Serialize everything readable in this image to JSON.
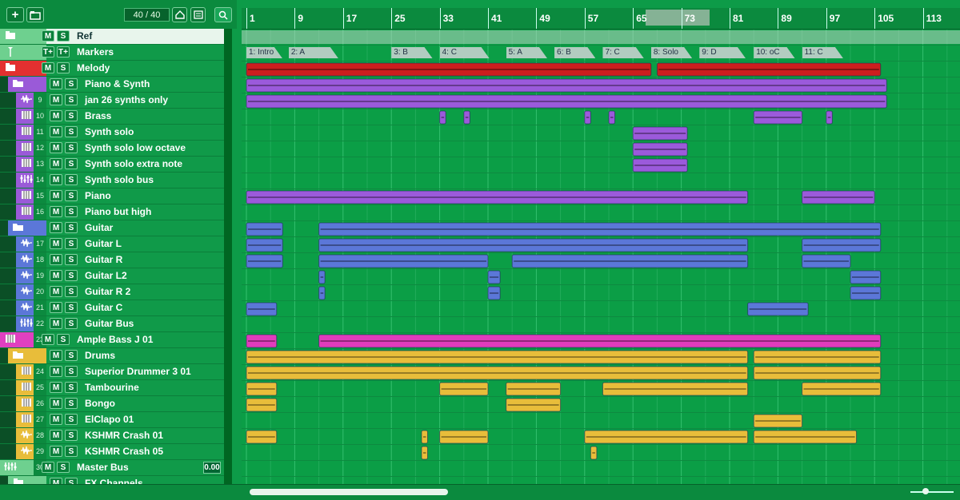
{
  "toolbar": {
    "add_track": "+",
    "track_count": "40 / 40"
  },
  "ruler": {
    "bars": [
      "1",
      "9",
      "17",
      "25",
      "33",
      "41",
      "49",
      "57",
      "65",
      "73",
      "81",
      "89",
      "97",
      "105",
      "113"
    ],
    "loop_label": "73"
  },
  "markers": [
    {
      "label": "1: Intro",
      "bar": 1
    },
    {
      "label": "2: A",
      "bar": 8
    },
    {
      "label": "3: B",
      "bar": 25
    },
    {
      "label": "4: C",
      "bar": 33
    },
    {
      "label": "5: A",
      "bar": 44
    },
    {
      "label": "6: B",
      "bar": 52
    },
    {
      "label": "7: C",
      "bar": 60
    },
    {
      "label": "8: Solo",
      "bar": 68
    },
    {
      "label": "9: D",
      "bar": 76
    },
    {
      "label": "10: oC",
      "bar": 85
    },
    {
      "label": "11: C",
      "bar": 93
    }
  ],
  "tracks": [
    {
      "num": "",
      "name": "Ref",
      "color": "#6ed08f",
      "icon": "folder-icon",
      "kind": "folder",
      "indent": 0
    },
    {
      "num": "",
      "name": "Markers",
      "color": "#6ed08f",
      "icon": "marker-icon",
      "kind": "marker",
      "indent": 0
    },
    {
      "num": "",
      "name": "Melody",
      "color": "#e33030",
      "icon": "folder-icon",
      "kind": "folder",
      "indent": 0
    },
    {
      "num": "",
      "name": "Piano & Synth",
      "color": "#9a5ad8",
      "icon": "folder-open-icon",
      "kind": "folder",
      "indent": 1
    },
    {
      "num": "9",
      "name": "jan 26 synths only",
      "color": "#9a5ad8",
      "icon": "audio-wave-icon",
      "kind": "audio",
      "indent": 2
    },
    {
      "num": "10",
      "name": "Brass",
      "color": "#9a5ad8",
      "icon": "instrument-icon",
      "kind": "inst",
      "indent": 2
    },
    {
      "num": "11",
      "name": "Synth solo",
      "color": "#9a5ad8",
      "icon": "instrument-icon",
      "kind": "inst",
      "indent": 2
    },
    {
      "num": "12",
      "name": "Synth solo low octave",
      "color": "#9a5ad8",
      "icon": "instrument-icon",
      "kind": "inst",
      "indent": 2
    },
    {
      "num": "13",
      "name": "Synth solo extra note",
      "color": "#9a5ad8",
      "icon": "instrument-icon",
      "kind": "inst",
      "indent": 2
    },
    {
      "num": "14",
      "name": "Synth solo bus",
      "color": "#9a5ad8",
      "icon": "bus-icon",
      "kind": "bus",
      "indent": 2
    },
    {
      "num": "15",
      "name": "Piano",
      "color": "#9a5ad8",
      "icon": "instrument-icon",
      "kind": "inst",
      "indent": 2
    },
    {
      "num": "16",
      "name": "Piano but high",
      "color": "#9a5ad8",
      "icon": "instrument-icon",
      "kind": "inst",
      "indent": 2
    },
    {
      "num": "",
      "name": "Guitar",
      "color": "#5b77d8",
      "icon": "folder-open-icon",
      "kind": "folder",
      "indent": 1
    },
    {
      "num": "17",
      "name": "Guitar L",
      "color": "#5b77d8",
      "icon": "audio-wave-icon",
      "kind": "audio",
      "indent": 2
    },
    {
      "num": "18",
      "name": "Guitar R",
      "color": "#5b77d8",
      "icon": "audio-wave-icon",
      "kind": "audio",
      "indent": 2
    },
    {
      "num": "19",
      "name": "Guitar L2",
      "color": "#5b77d8",
      "icon": "audio-wave-icon",
      "kind": "audio",
      "indent": 2
    },
    {
      "num": "20",
      "name": "Guitar R 2",
      "color": "#5b77d8",
      "icon": "audio-wave-icon",
      "kind": "audio",
      "indent": 2
    },
    {
      "num": "21",
      "name": "Guitar C",
      "color": "#5b77d8",
      "icon": "audio-wave-icon",
      "kind": "audio",
      "indent": 2
    },
    {
      "num": "22",
      "name": "Guitar Bus",
      "color": "#5b77d8",
      "icon": "bus-icon",
      "kind": "bus",
      "indent": 2
    },
    {
      "num": "23",
      "name": "Ample Bass J 01",
      "color": "#e040c0",
      "icon": "instrument-icon",
      "kind": "inst",
      "indent": 0
    },
    {
      "num": "",
      "name": "Drums",
      "color": "#e8bd3a",
      "icon": "folder-open-icon",
      "kind": "folder",
      "indent": 1
    },
    {
      "num": "24",
      "name": "Superior Drummer 3 01",
      "color": "#e8bd3a",
      "icon": "instrument-icon",
      "kind": "inst",
      "indent": 2
    },
    {
      "num": "25",
      "name": "Tambourine",
      "color": "#e8bd3a",
      "icon": "instrument-icon",
      "kind": "inst",
      "indent": 2
    },
    {
      "num": "26",
      "name": "Bongo",
      "color": "#e8bd3a",
      "icon": "instrument-icon",
      "kind": "inst",
      "indent": 2
    },
    {
      "num": "27",
      "name": "ElClapo 01",
      "color": "#e8bd3a",
      "icon": "instrument-icon",
      "kind": "inst",
      "indent": 2
    },
    {
      "num": "28",
      "name": "KSHMR Crash 01",
      "color": "#e8bd3a",
      "icon": "audio-wave-icon",
      "kind": "audio",
      "indent": 2
    },
    {
      "num": "29",
      "name": "KSHMR Crash 05",
      "color": "#e8bd3a",
      "icon": "audio-wave-icon",
      "kind": "audio",
      "indent": 2
    },
    {
      "num": "30",
      "name": "Master Bus",
      "color": "#6ed08f",
      "icon": "bus-icon",
      "kind": "master",
      "indent": 0
    },
    {
      "num": "",
      "name": "FX Channels",
      "color": "#6ed08f",
      "icon": "folder-icon",
      "kind": "folder",
      "indent": 1
    }
  ],
  "master": {
    "volume": "0.00"
  },
  "clips": [
    {
      "row": 2,
      "start": 1,
      "end": 68,
      "color": "#cc1e1e"
    },
    {
      "row": 2,
      "start": 69,
      "end": 106,
      "color": "#cc1e1e"
    },
    {
      "row": 3,
      "start": 1,
      "end": 107,
      "color": "#9b5adb"
    },
    {
      "row": 4,
      "start": 1,
      "end": 107,
      "color": "#9b5adb"
    },
    {
      "row": 5,
      "start": 33,
      "end": 34,
      "color": "#9b5adb"
    },
    {
      "row": 5,
      "start": 37,
      "end": 38,
      "color": "#9b5adb"
    },
    {
      "row": 5,
      "start": 57,
      "end": 58,
      "color": "#9b5adb"
    },
    {
      "row": 5,
      "start": 61,
      "end": 62,
      "color": "#9b5adb"
    },
    {
      "row": 5,
      "start": 85,
      "end": 93,
      "color": "#9b5adb"
    },
    {
      "row": 5,
      "start": 97,
      "end": 98,
      "color": "#9b5adb"
    },
    {
      "row": 6,
      "start": 65,
      "end": 74,
      "color": "#9b5adb"
    },
    {
      "row": 7,
      "start": 65,
      "end": 74,
      "color": "#9b5adb"
    },
    {
      "row": 8,
      "start": 65,
      "end": 74,
      "color": "#9b5adb"
    },
    {
      "row": 10,
      "start": 1,
      "end": 84,
      "color": "#9b5adb"
    },
    {
      "row": 10,
      "start": 93,
      "end": 105,
      "color": "#9b5adb"
    },
    {
      "row": 12,
      "start": 1,
      "end": 7,
      "color": "#5b77d8"
    },
    {
      "row": 12,
      "start": 13,
      "end": 106,
      "color": "#5b77d8"
    },
    {
      "row": 13,
      "start": 1,
      "end": 7,
      "color": "#5b77d8"
    },
    {
      "row": 13,
      "start": 13,
      "end": 84,
      "color": "#5b77d8"
    },
    {
      "row": 13,
      "start": 93,
      "end": 106,
      "color": "#5b77d8"
    },
    {
      "row": 14,
      "start": 1,
      "end": 7,
      "color": "#5b77d8"
    },
    {
      "row": 14,
      "start": 13,
      "end": 41,
      "color": "#5b77d8"
    },
    {
      "row": 14,
      "start": 45,
      "end": 84,
      "color": "#5b77d8"
    },
    {
      "row": 14,
      "start": 93,
      "end": 101,
      "color": "#5b77d8"
    },
    {
      "row": 15,
      "start": 13,
      "end": 14,
      "color": "#5b77d8"
    },
    {
      "row": 15,
      "start": 41,
      "end": 43,
      "color": "#5b77d8"
    },
    {
      "row": 15,
      "start": 101,
      "end": 106,
      "color": "#5b77d8"
    },
    {
      "row": 16,
      "start": 13,
      "end": 14,
      "color": "#5b77d8"
    },
    {
      "row": 16,
      "start": 41,
      "end": 43,
      "color": "#5b77d8"
    },
    {
      "row": 16,
      "start": 101,
      "end": 106,
      "color": "#5b77d8"
    },
    {
      "row": 17,
      "start": 1,
      "end": 6,
      "color": "#5b77d8"
    },
    {
      "row": 17,
      "start": 84,
      "end": 94,
      "color": "#5b77d8"
    },
    {
      "row": 19,
      "start": 1,
      "end": 6,
      "color": "#e03cbc"
    },
    {
      "row": 19,
      "start": 13,
      "end": 106,
      "color": "#e03cbc"
    },
    {
      "row": 20,
      "start": 1,
      "end": 84,
      "color": "#e8bd3a"
    },
    {
      "row": 20,
      "start": 85,
      "end": 106,
      "color": "#e8bd3a"
    },
    {
      "row": 21,
      "start": 1,
      "end": 84,
      "color": "#e8bd3a"
    },
    {
      "row": 21,
      "start": 85,
      "end": 106,
      "color": "#e8bd3a"
    },
    {
      "row": 22,
      "start": 1,
      "end": 6,
      "color": "#e8bd3a"
    },
    {
      "row": 22,
      "start": 33,
      "end": 41,
      "color": "#e8bd3a"
    },
    {
      "row": 22,
      "start": 44,
      "end": 53,
      "color": "#e8bd3a"
    },
    {
      "row": 22,
      "start": 60,
      "end": 84,
      "color": "#e8bd3a"
    },
    {
      "row": 22,
      "start": 93,
      "end": 106,
      "color": "#e8bd3a"
    },
    {
      "row": 23,
      "start": 1,
      "end": 6,
      "color": "#e8bd3a"
    },
    {
      "row": 23,
      "start": 44,
      "end": 53,
      "color": "#e8bd3a"
    },
    {
      "row": 24,
      "start": 85,
      "end": 93,
      "color": "#e8bd3a"
    },
    {
      "row": 25,
      "start": 1,
      "end": 6,
      "color": "#e8bd3a"
    },
    {
      "row": 25,
      "start": 30,
      "end": 31,
      "color": "#e8bd3a"
    },
    {
      "row": 25,
      "start": 33,
      "end": 41,
      "color": "#e8bd3a"
    },
    {
      "row": 25,
      "start": 57,
      "end": 84,
      "color": "#e8bd3a"
    },
    {
      "row": 25,
      "start": 85,
      "end": 102,
      "color": "#e8bd3a"
    },
    {
      "row": 26,
      "start": 30,
      "end": 31,
      "color": "#e8bd3a"
    },
    {
      "row": 26,
      "start": 58,
      "end": 59,
      "color": "#e8bd3a"
    }
  ]
}
